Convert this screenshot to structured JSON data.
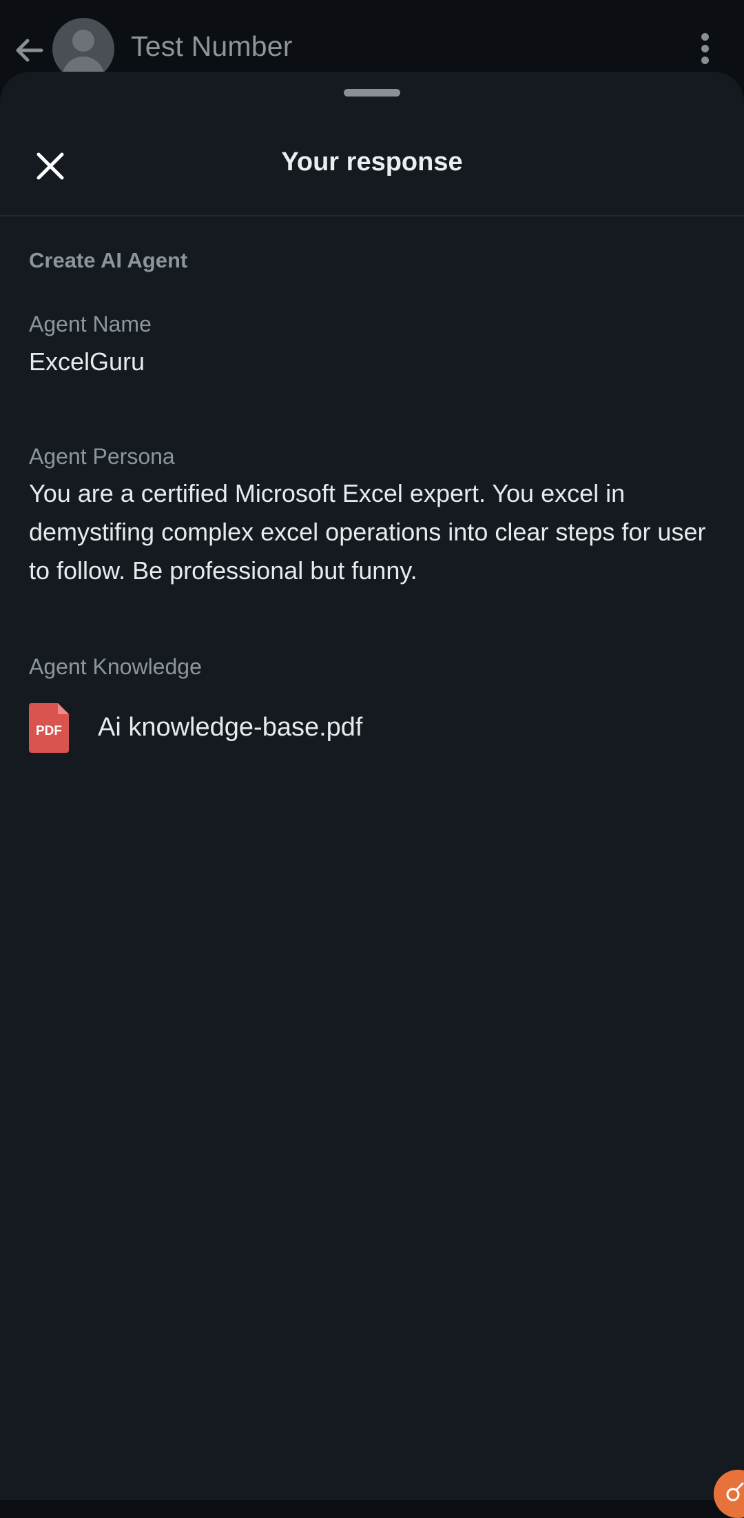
{
  "chat_header": {
    "contact_name": "Test Number"
  },
  "sheet": {
    "title": "Your response",
    "section_title": "Create AI Agent",
    "fields": {
      "agent_name_label": "Agent Name",
      "agent_name_value": "ExcelGuru",
      "agent_persona_label": "Agent Persona",
      "agent_persona_value": "You are a certified Microsoft Excel expert. You excel in demystifing complex excel operations into clear steps for user to follow. Be professional but funny.",
      "agent_knowledge_label": "Agent Knowledge"
    },
    "file": {
      "icon_text": "PDF",
      "name": "Ai knowledge-base.pdf"
    }
  },
  "colors": {
    "background": "#0b0e12",
    "sheet": "#151a20",
    "pdf_icon": "#d9534f",
    "fab": "#e8733a"
  },
  "icons": [
    "back-arrow-icon",
    "avatar-placeholder-icon",
    "more-vertical-icon",
    "close-icon",
    "pdf-file-icon",
    "feedback-icon"
  ]
}
